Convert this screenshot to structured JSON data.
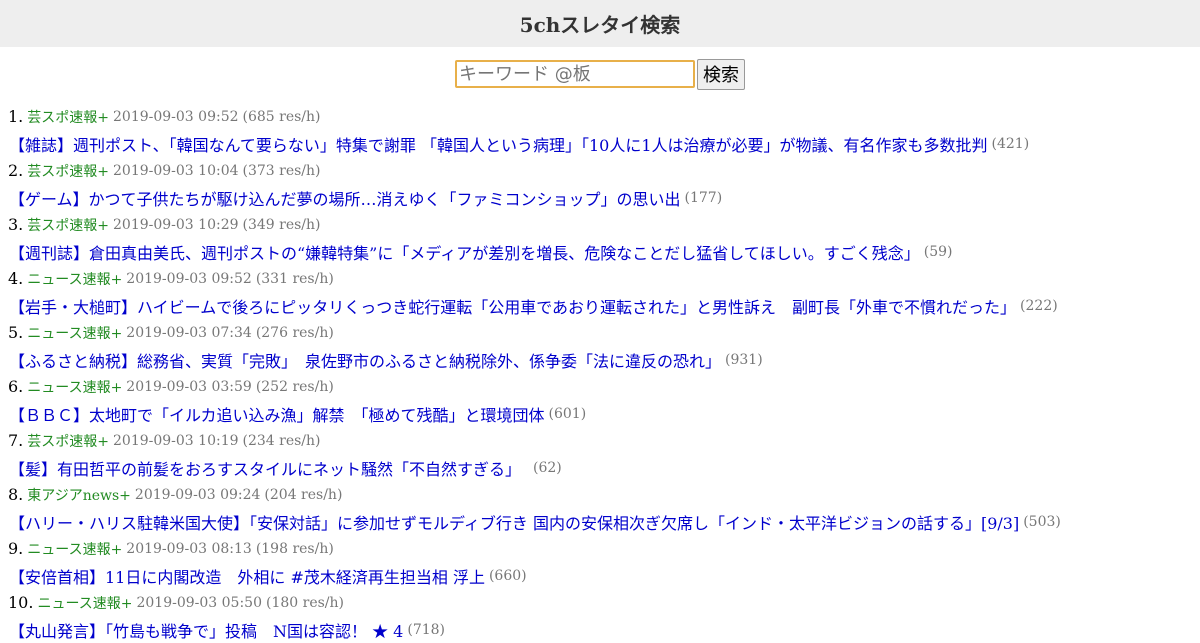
{
  "header": {
    "title": "5chスレタイ検索"
  },
  "search": {
    "placeholder": "キーワード @板",
    "button_label": "検索"
  },
  "results": [
    {
      "rank": "1.",
      "board": "芸スポ速報+",
      "date": "2019-09-03 09:52",
      "rate": "(685 res/h)",
      "title": "【雑誌】週刊ポスト、「韓国なんて要らない」特集で謝罪 「韓国人という病理」「10人に1人は治療が必要」が物議、有名作家も多数批判",
      "count": "(421)"
    },
    {
      "rank": "2.",
      "board": "芸スポ速報+",
      "date": "2019-09-03 10:04",
      "rate": "(373 res/h)",
      "title": "【ゲーム】かつて子供たちが駆け込んだ夢の場所…消えゆく「ファミコンショップ」の思い出",
      "count": "(177)"
    },
    {
      "rank": "3.",
      "board": "芸スポ速報+",
      "date": "2019-09-03 10:29",
      "rate": "(349 res/h)",
      "title": "【週刊誌】倉田真由美氏、週刊ポストの“嫌韓特集”に「メディアが差別を増長、危険なことだし猛省してほしい。すごく残念」",
      "count": "(59)"
    },
    {
      "rank": "4.",
      "board": "ニュース速報+",
      "date": "2019-09-03 09:52",
      "rate": "(331 res/h)",
      "title": "【岩手・大槌町】ハイビームで後ろにピッタリくっつき蛇行運転「公用車であおり運転された」と男性訴え　副町長「外車で不慣れだった」",
      "count": "(222)"
    },
    {
      "rank": "5.",
      "board": "ニュース速報+",
      "date": "2019-09-03 07:34",
      "rate": "(276 res/h)",
      "title": "【ふるさと納税】総務省、実質「完敗」　泉佐野市のふるさと納税除外、係争委「法に違反の恐れ」",
      "count": "(931)"
    },
    {
      "rank": "6.",
      "board": "ニュース速報+",
      "date": "2019-09-03 03:59",
      "rate": "(252 res/h)",
      "title": "【ＢＢＣ】太地町で「イルカ追い込み漁」解禁　「極めて残酷」と環境団体",
      "count": "(601)"
    },
    {
      "rank": "7.",
      "board": "芸スポ速報+",
      "date": "2019-09-03 10:19",
      "rate": "(234 res/h)",
      "title": "【髪】有田哲平の前髪をおろすスタイルにネット騒然「不自然すぎる」　",
      "count": "(62)"
    },
    {
      "rank": "8.",
      "board": "東アジアnews+",
      "date": "2019-09-03 09:24",
      "rate": "(204 res/h)",
      "title": "【ハリー・ハリス駐韓米国大使】「安保対話」に参加せずモルディブ行き 国内の安保相次ぎ欠席し「インド・太平洋ビジョンの話する」[9/3]",
      "count": "(503)"
    },
    {
      "rank": "9.",
      "board": "ニュース速報+",
      "date": "2019-09-03 08:13",
      "rate": "(198 res/h)",
      "title": "【安倍首相】11日に内閣改造　外相に #茂木経済再生担当相 浮上",
      "count": "(660)"
    },
    {
      "rank": "10.",
      "board": "ニュース速報+",
      "date": "2019-09-03 05:50",
      "rate": "(180 res/h)",
      "title": "【丸山発言】「竹島も戦争で」投稿　N国は容認！ ★ 4",
      "count": "(718)"
    }
  ]
}
